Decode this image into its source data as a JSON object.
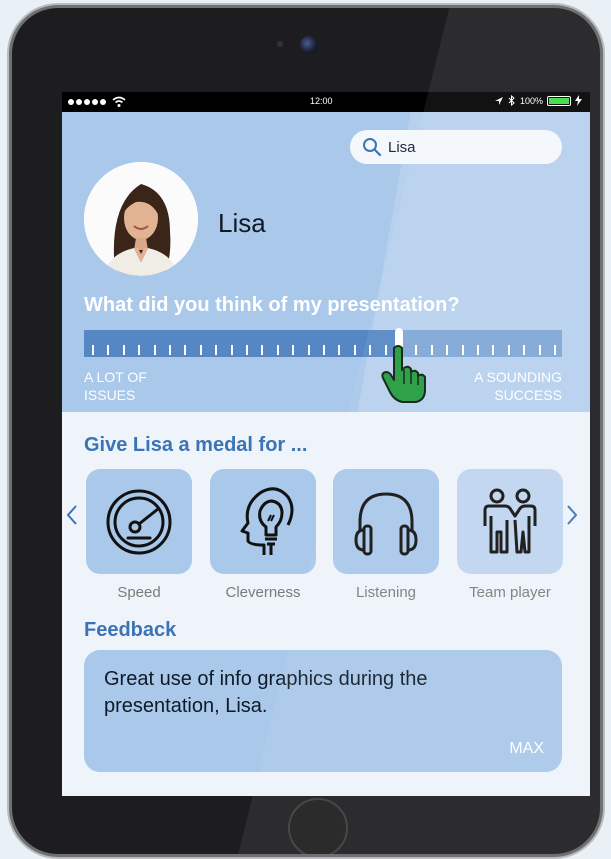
{
  "status_bar": {
    "time": "12:00",
    "battery": "100%",
    "battery_level": 1.0
  },
  "search": {
    "value": "Lisa",
    "icon": "search-icon"
  },
  "profile": {
    "name": "Lisa"
  },
  "rating": {
    "question": "What did you think of my presentation?",
    "scale_min": "A LOT OF\nISSUES",
    "scale_max": "A SOUNDING\nSUCCESS",
    "value_fraction": 0.66
  },
  "medals": {
    "title": "Give Lisa a medal for ...",
    "items": [
      {
        "label": "Speed",
        "icon": "speedometer-icon"
      },
      {
        "label": "Cleverness",
        "icon": "lightbulb-head-icon"
      },
      {
        "label": "Listening",
        "icon": "headphones-icon"
      },
      {
        "label": "Team player",
        "icon": "two-people-icon"
      }
    ],
    "prev_icon": "chevron-left-icon",
    "next_icon": "chevron-right-icon"
  },
  "feedback": {
    "title": "Feedback",
    "text": "Great use of info graphics during the presentation, Lisa.",
    "max_label": "MAX"
  },
  "colors": {
    "accent": "#3a74b6",
    "panel": "#a9c8ea",
    "slider_fill": "#5487c4",
    "cursor": "#1f9a3c"
  }
}
